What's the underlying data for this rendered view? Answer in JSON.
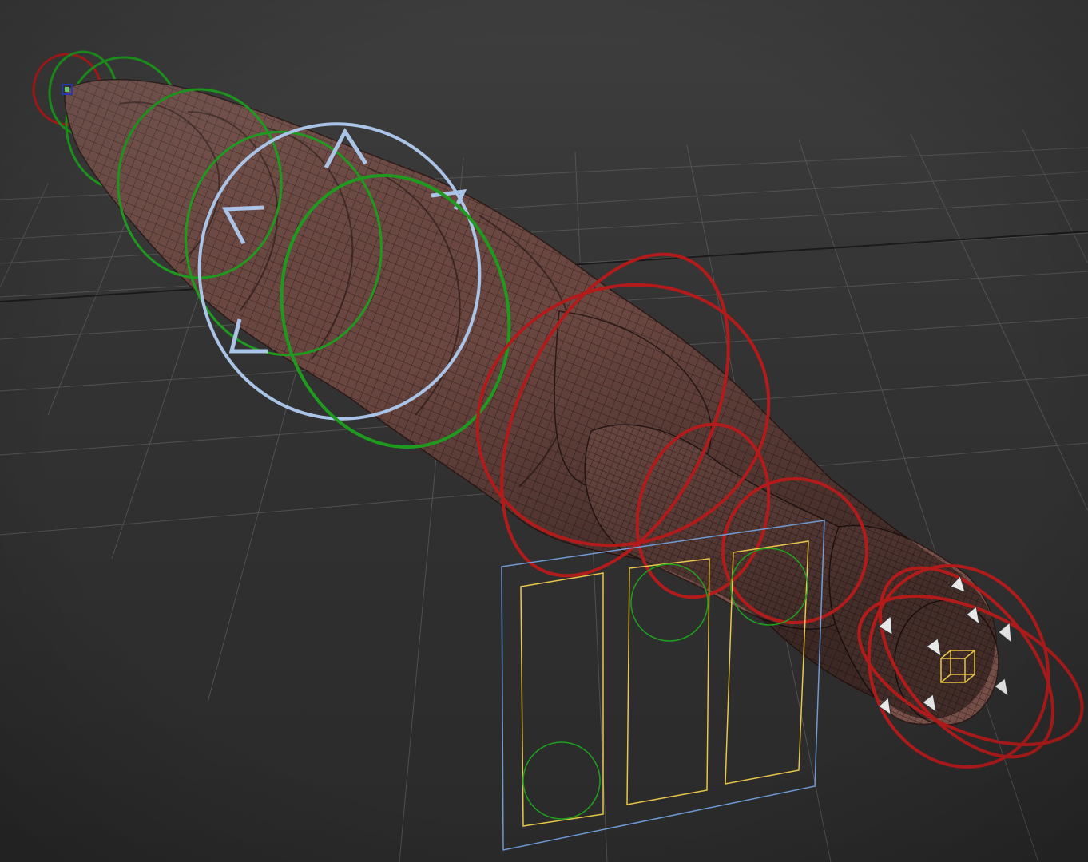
{
  "viewport": {
    "colors": {
      "background_top": "#3e3e3e",
      "background_bottom": "#2a2a2a",
      "grid": "#5a5a5a",
      "grid_axis": "#1e1e1e",
      "mesh_fill": "#6b4741",
      "mesh_fill_dark": "#3e2724",
      "mesh_wire": "#2b1a17",
      "control_red": "#b31b1b",
      "control_green": "#1e9a1e",
      "control_blue": "#a9c4e6",
      "ui_panel_frame": "#6f9bd4",
      "ui_slot_frame": "#e8c64a",
      "ui_slot_circle": "#1ea01e",
      "handle": "#e8e8e8"
    },
    "controls": {
      "ring_groups": [
        "red",
        "green",
        "blue",
        "green",
        "red"
      ],
      "ui_panel": {
        "slot_count": 3,
        "slot_icons": [
          "circle-bottom",
          "circle-top",
          "circle-top"
        ]
      },
      "icons": [
        "root-gizmo-icon",
        "ik-target-box-icon",
        "handle-pyramid-icon"
      ]
    }
  }
}
